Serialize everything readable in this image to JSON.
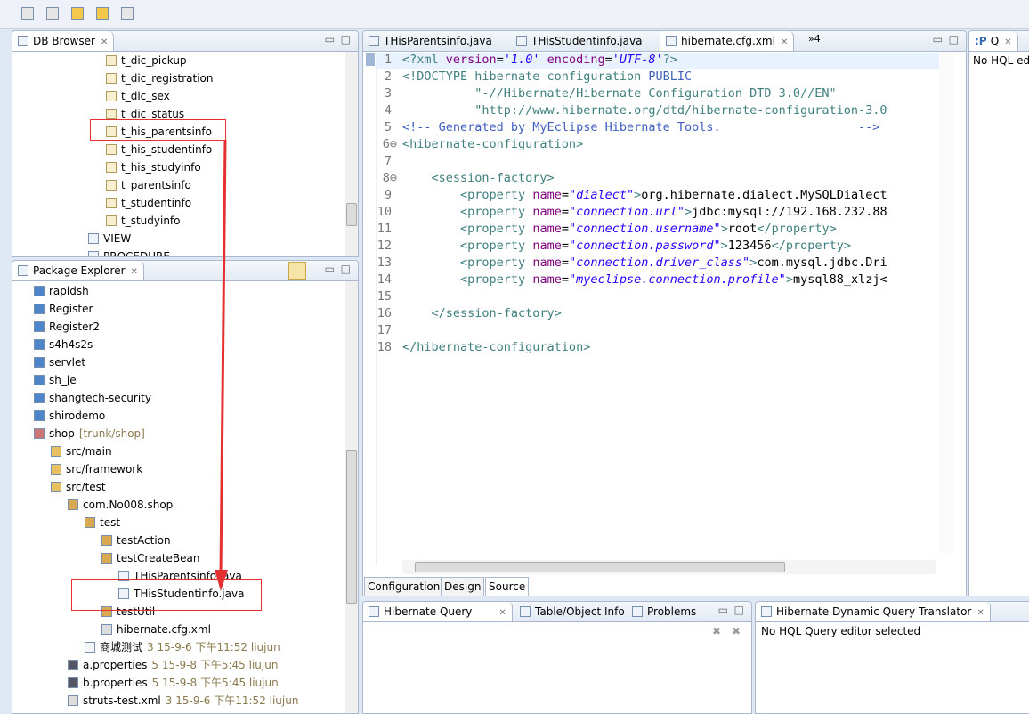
{
  "toolbar": {
    "icons": [
      "history-icon",
      "history2-icon",
      "last-edit-icon",
      "back-icon",
      "forward-icon"
    ]
  },
  "db_browser": {
    "title": "DB Browser",
    "items": [
      "t_dic_pickup",
      "t_dic_registration",
      "t_dic_sex",
      "t_dic_status",
      "t_his_parentsinfo",
      "t_his_studentinfo",
      "t_his_studyinfo",
      "t_parentsinfo",
      "t_studentinfo",
      "t_studyinfo"
    ],
    "view_label": "VIEW",
    "procedure_label": "PROCEDURE"
  },
  "package_explorer": {
    "title": "Package Explorer",
    "items": [
      {
        "label": "rapidsh",
        "level": 0,
        "icon": "folder"
      },
      {
        "label": "Register",
        "level": 0,
        "icon": "folder"
      },
      {
        "label": "Register2",
        "level": 0,
        "icon": "folder"
      },
      {
        "label": "s4h4s2s",
        "level": 0,
        "icon": "folder"
      },
      {
        "label": "servlet",
        "level": 0,
        "icon": "folder"
      },
      {
        "label": "sh_je",
        "level": 0,
        "icon": "folder"
      },
      {
        "label": "shangtech-security",
        "level": 0,
        "icon": "folder"
      },
      {
        "label": "shirodemo",
        "level": 0,
        "icon": "folder"
      },
      {
        "label": "shop",
        "meta": "[trunk/shop]",
        "level": 0,
        "icon": "project"
      },
      {
        "label": "src/main",
        "level": 1,
        "icon": "src"
      },
      {
        "label": "src/framework",
        "level": 1,
        "icon": "src"
      },
      {
        "label": "src/test",
        "level": 1,
        "icon": "src"
      },
      {
        "label": "com.No008.shop",
        "level": 2,
        "icon": "package"
      },
      {
        "label": "test",
        "level": 3,
        "icon": "package"
      },
      {
        "label": "testAction",
        "level": 4,
        "icon": "package"
      },
      {
        "label": "testCreateBean",
        "level": 4,
        "icon": "package"
      },
      {
        "label": "THisParentsinfo.java",
        "level": 5,
        "icon": "java"
      },
      {
        "label": "THisStudentinfo.java",
        "level": 5,
        "icon": "java"
      },
      {
        "label": "testUtil",
        "level": 4,
        "icon": "package"
      },
      {
        "label": "hibernate.cfg.xml",
        "level": 4,
        "icon": "xml"
      },
      {
        "label": "商城测试",
        "meta": "3  15-9-6 下午11:52  liujun",
        "level": 3,
        "icon": "file"
      },
      {
        "label": "a.properties",
        "meta": "5  15-9-8 下午5:45  liujun",
        "level": 2,
        "icon": "props"
      },
      {
        "label": "b.properties",
        "meta": "5  15-9-8 下午5:45  liujun",
        "level": 2,
        "icon": "props"
      },
      {
        "label": "struts-test.xml",
        "meta": "3  15-9-6 下午11:52  liujun",
        "level": 2,
        "icon": "xml"
      }
    ]
  },
  "editor": {
    "tabs": [
      "THisParentsinfo.java",
      "THisStudentinfo.java",
      "hibernate.cfg.xml"
    ],
    "overflow": "»4",
    "bottom_tabs": [
      "Configuration",
      "Design",
      "Source"
    ],
    "lines": [
      [
        [
          "pi",
          "<?xml "
        ],
        [
          "at",
          "version"
        ],
        [
          "",
          "="
        ],
        [
          "vl",
          "'1.0'"
        ],
        [
          "at",
          " encoding"
        ],
        [
          "",
          "="
        ],
        [
          "vl",
          "'UTF-8'"
        ],
        [
          "pi",
          "?>"
        ]
      ],
      [
        [
          "tg",
          "<!DOCTYPE hibernate-configuration "
        ],
        [
          "cm",
          "PUBLIC"
        ]
      ],
      [
        [
          "tg",
          "          \"-//Hibernate/Hibernate Configuration DTD 3.0//EN\""
        ]
      ],
      [
        [
          "tg",
          "          \"http://www.hibernate.org/dtd/hibernate-configuration-3.0"
        ]
      ],
      [
        [
          "cm",
          "<!-- Generated by MyEclipse Hibernate Tools.                   -->"
        ]
      ],
      [
        [
          "tg",
          "<hibernate-configuration>"
        ]
      ],
      [],
      [
        [
          "tg",
          "    <session-factory>"
        ]
      ],
      [
        [
          "tg",
          "        <property "
        ],
        [
          "at",
          "name"
        ],
        [
          "",
          "="
        ],
        [
          "vl",
          "\"dialect\""
        ],
        [
          "tg",
          ">"
        ],
        [
          "",
          "org.hibernate.dialect.MySQLDialect"
        ]
      ],
      [
        [
          "tg",
          "        <property "
        ],
        [
          "at",
          "name"
        ],
        [
          "",
          "="
        ],
        [
          "vl",
          "\"connection.url\""
        ],
        [
          "tg",
          ">"
        ],
        [
          "",
          "jdbc:mysql://192.168.232.88"
        ]
      ],
      [
        [
          "tg",
          "        <property "
        ],
        [
          "at",
          "name"
        ],
        [
          "",
          "="
        ],
        [
          "vl",
          "\"connection.username\""
        ],
        [
          "tg",
          ">"
        ],
        [
          "",
          "root"
        ],
        [
          "tg",
          "</property>"
        ]
      ],
      [
        [
          "tg",
          "        <property "
        ],
        [
          "at",
          "name"
        ],
        [
          "",
          "="
        ],
        [
          "vl",
          "\"connection.password\""
        ],
        [
          "tg",
          ">"
        ],
        [
          "",
          "123456"
        ],
        [
          "tg",
          "</property>"
        ]
      ],
      [
        [
          "tg",
          "        <property "
        ],
        [
          "at",
          "name"
        ],
        [
          "",
          "="
        ],
        [
          "vl",
          "\"connection.driver_class\""
        ],
        [
          "tg",
          ">"
        ],
        [
          "",
          "com.mysql.jdbc.Dri"
        ]
      ],
      [
        [
          "tg",
          "        <property "
        ],
        [
          "at",
          "name"
        ],
        [
          "",
          "="
        ],
        [
          "vl",
          "\"myeclipse.connection.profile\""
        ],
        [
          "tg",
          ">"
        ],
        [
          "",
          "mysql88_xlzj<"
        ]
      ],
      [],
      [
        [
          "tg",
          "    </session-factory>"
        ]
      ],
      [],
      [
        [
          "tg",
          "</hibernate-configuration>"
        ]
      ]
    ]
  },
  "q_panel": {
    "title": "Q",
    "text": "No HQL ed"
  },
  "hibernate_query": {
    "tabs": [
      "Hibernate Query",
      "Table/Object Info",
      "Problems"
    ]
  },
  "translator": {
    "title": "Hibernate Dynamic Query Translator",
    "text": "No HQL Query editor selected"
  },
  "colors": {
    "highlight_box": "#e43030",
    "tag": "#3f7f7f",
    "attribute": "#7f007f",
    "value": "#2a00ff"
  }
}
